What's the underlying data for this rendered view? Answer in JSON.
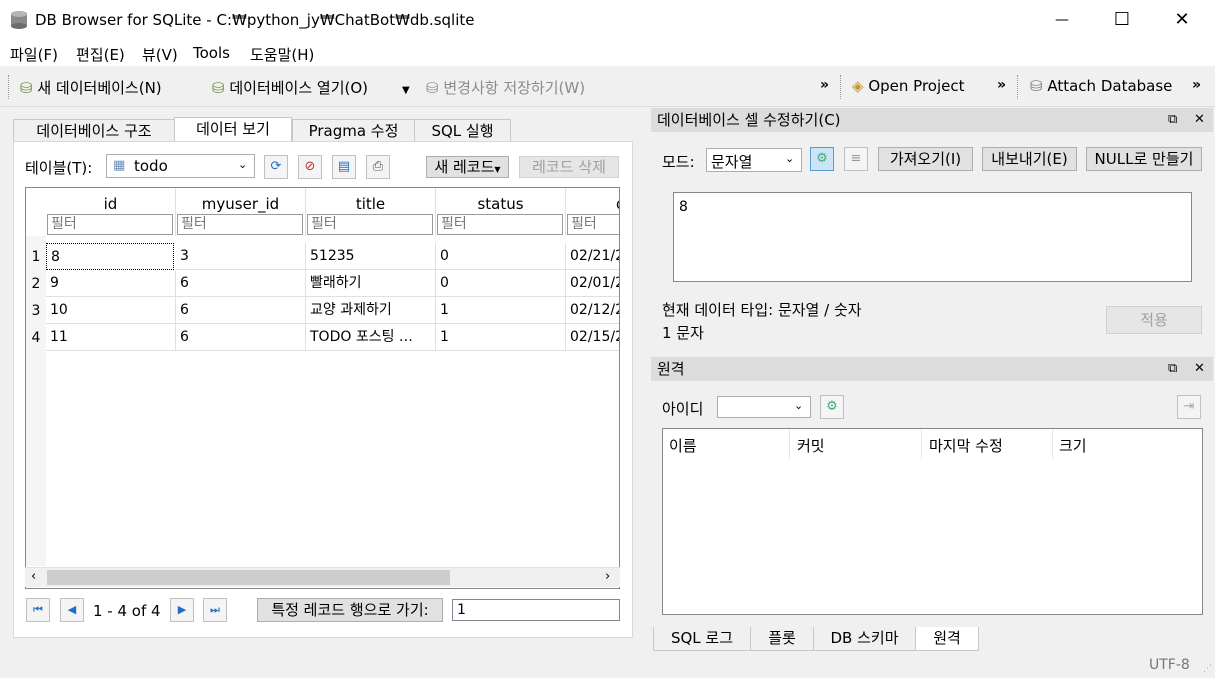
{
  "window": {
    "title": "DB Browser for SQLite - C:₩python_jy₩ChatBot₩db.sqlite",
    "minimize": "—",
    "maximize": "☐",
    "close": "✕"
  },
  "menu": [
    "파일(F)",
    "편집(E)",
    "뷰(V)",
    "Tools",
    "도움말(H)"
  ],
  "toolbar": {
    "new_db": "새 데이터베이스(N)",
    "open_db": "데이터베이스 열기(O)",
    "write_changes": "변경사항 저장하기(W)",
    "open_project": "Open Project",
    "attach_db": "Attach Database",
    "more": "»"
  },
  "tabs": [
    "데이터베이스 구조",
    "데이터 보기",
    "Pragma 수정",
    "SQL 실행"
  ],
  "browse": {
    "table_label": "테이블(T):",
    "table_value": "todo",
    "new_record": "새 레코드",
    "delete_record": "레코드 삭제",
    "columns": [
      "id",
      "myuser_id",
      "title",
      "status",
      "d"
    ],
    "filter_placeholder": "필터",
    "rows": [
      {
        "num": "1",
        "cells": [
          "8",
          "3",
          "51235",
          "0",
          "02/21/2"
        ]
      },
      {
        "num": "2",
        "cells": [
          "9",
          "6",
          "빨래하기",
          "0",
          "02/01/2"
        ]
      },
      {
        "num": "3",
        "cells": [
          "10",
          "6",
          "교양 과제하기",
          "1",
          "02/12/2"
        ]
      },
      {
        "num": "4",
        "cells": [
          "11",
          "6",
          "TODO 포스팅 …",
          "1",
          "02/15/2"
        ]
      }
    ],
    "range_text": "1 - 4 of 4",
    "goto_label": "특정 레코드 행으로 가기:",
    "goto_value": "1"
  },
  "edit_cell": {
    "title": "데이터베이스 셀 수정하기(C)",
    "mode_label": "모드:",
    "mode_value": "문자열",
    "import": "가져오기(I)",
    "export": "내보내기(E)",
    "set_null": "NULL로 만들기",
    "content": "8",
    "type_info": "현재 데이터 타입: 문자열 / 숫자",
    "size_info": "1 문자",
    "apply": "적용"
  },
  "remote": {
    "title": "원격",
    "identity_label": "아이디",
    "columns": [
      "이름",
      "커밋",
      "마지막 수정",
      "크기"
    ]
  },
  "bottom_tabs": [
    "SQL 로그",
    "플롯",
    "DB 스키마",
    "원격"
  ],
  "status": {
    "encoding": "UTF-8"
  },
  "colors": {
    "accent": "#1e6ec8",
    "title_bg": "#ffffff",
    "dock_title_bg": "#dcdcdc"
  }
}
